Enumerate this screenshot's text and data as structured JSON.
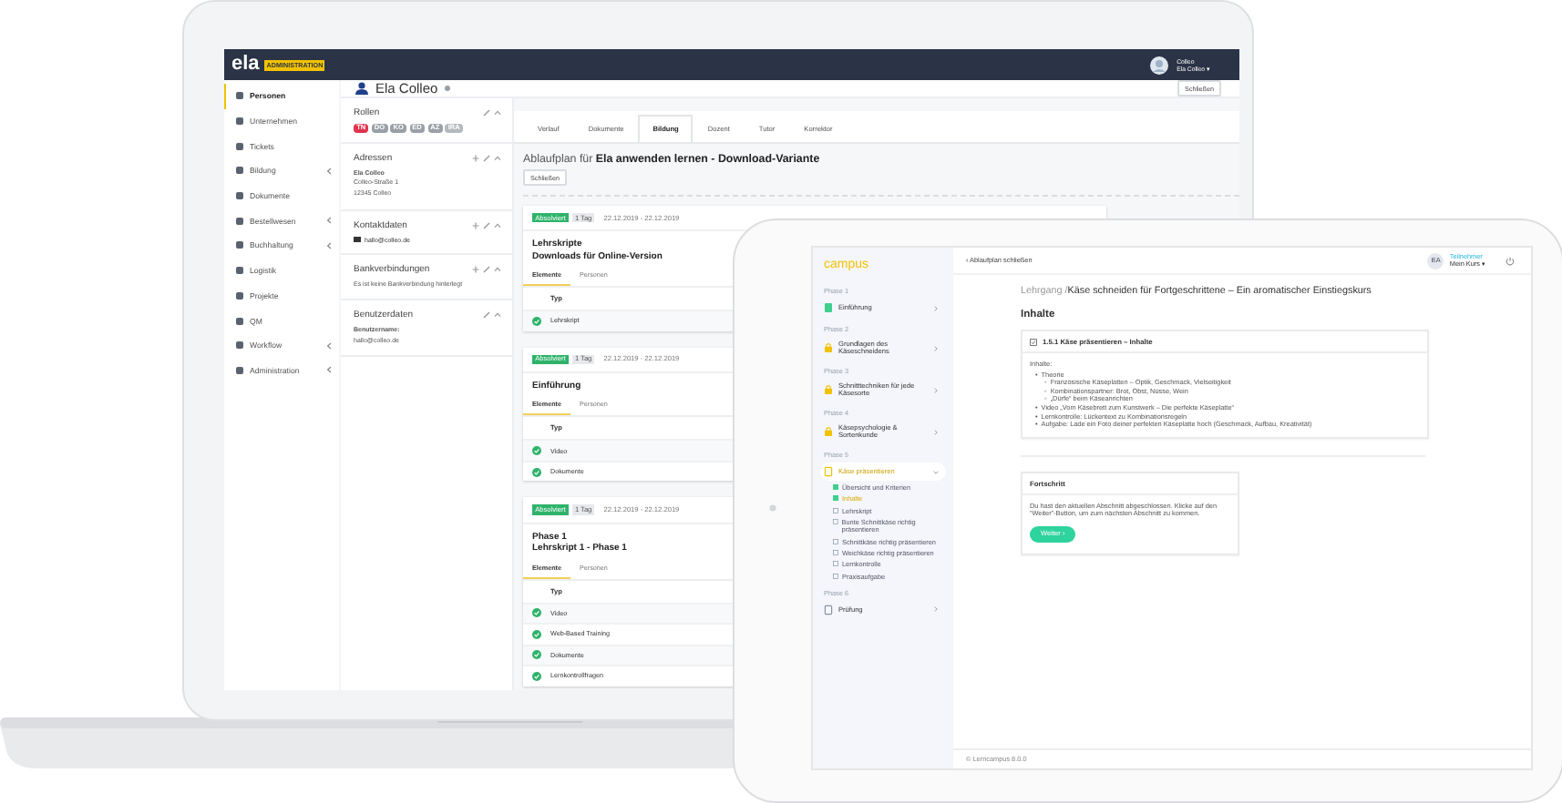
{
  "laptop": {
    "header": {
      "logo": "ela",
      "badge": "ADMINISTRATION",
      "user_line1": "Colleo",
      "user_line2": "Ela Colleo ▾"
    },
    "sidebar": [
      {
        "label": "Personen",
        "selected": true,
        "expandable": false
      },
      {
        "label": "Unternehmen",
        "selected": false,
        "expandable": false
      },
      {
        "label": "Tickets",
        "selected": false,
        "expandable": false
      },
      {
        "label": "Bildung",
        "selected": false,
        "expandable": true
      },
      {
        "label": "Dokumente",
        "selected": false,
        "expandable": false
      },
      {
        "label": "Bestellwesen",
        "selected": false,
        "expandable": true
      },
      {
        "label": "Buchhaltung",
        "selected": false,
        "expandable": true
      },
      {
        "label": "Logistik",
        "selected": false,
        "expandable": false
      },
      {
        "label": "Projekte",
        "selected": false,
        "expandable": false
      },
      {
        "label": "QM",
        "selected": false,
        "expandable": false
      },
      {
        "label": "Workflow",
        "selected": false,
        "expandable": true
      },
      {
        "label": "Administration",
        "selected": false,
        "expandable": true
      }
    ],
    "person": {
      "name": "Ela Colleo",
      "close": "Schließen"
    },
    "panels": [
      {
        "title": "Rollen",
        "addable": false,
        "roles": [
          {
            "label": "TN",
            "color": "#e0344c"
          },
          {
            "label": "DO",
            "color": "#9aa0a8"
          },
          {
            "label": "KO",
            "color": "#9aa0a8"
          },
          {
            "label": "ED",
            "color": "#9aa0a8"
          },
          {
            "label": "AZ",
            "color": "#9aa0a8"
          },
          {
            "label": "IRA",
            "color": "#b4b9bf"
          }
        ]
      },
      {
        "title": "Adressen",
        "addable": true,
        "lines": [
          "**Ela Colleo**",
          "Colleo-Straße 1",
          "12345 Colleo"
        ]
      },
      {
        "title": "Kontaktdaten",
        "addable": true,
        "email": "hallo@colleo.de"
      },
      {
        "title": "Bankverbindungen",
        "addable": true,
        "lines": [
          "Es ist keine Bankverbindung hinterlegt"
        ]
      },
      {
        "title": "Benutzerdaten",
        "addable": false,
        "lines": [
          "**Benutzername:**",
          "hallo@colleo.de"
        ]
      }
    ],
    "tabs": [
      {
        "label": "Verlauf",
        "selected": false
      },
      {
        "label": "Dokumente",
        "selected": false
      },
      {
        "label": "Bildung",
        "selected": true
      },
      {
        "label": "Dozent",
        "selected": false
      },
      {
        "label": "Tutor",
        "selected": false
      },
      {
        "label": "Korrektor",
        "selected": false
      }
    ],
    "plan_title": "Ablaufplan für **Ela anwenden lernen - Download-Variante**",
    "plan_close": "Schließen",
    "cards": [
      {
        "status": "Absolviert",
        "duration": "1 Tag",
        "dates": "22.12.2019 - 22.12.2019",
        "title_lines": [
          "Lehrskripte",
          "Downloads für Online-Version"
        ],
        "tabs": [
          {
            "label": "Elemente",
            "selected": true
          },
          {
            "label": "Personen",
            "selected": false
          }
        ],
        "column": "Typ",
        "rows": [
          "Lehrskript"
        ]
      },
      {
        "status": "Absolviert",
        "duration": "1 Tag",
        "dates": "22.12.2019 - 22.12.2019",
        "title_lines": [
          "Einführung"
        ],
        "tabs": [
          {
            "label": "Elemente",
            "selected": true
          },
          {
            "label": "Personen",
            "selected": false
          }
        ],
        "column": "Typ",
        "rows": [
          "Video",
          "Dokumente"
        ]
      },
      {
        "status": "Absolviert",
        "duration": "1 Tag",
        "dates": "22.12.2019 - 22.12.2019",
        "title_lines": [
          "Phase 1",
          "Lehrskript 1 - Phase 1"
        ],
        "tabs": [
          {
            "label": "Elemente",
            "selected": true
          },
          {
            "label": "Personen",
            "selected": false
          }
        ],
        "column": "Typ",
        "rows": [
          "Video",
          "Web-Based Training",
          "Dokumente",
          "Lernkontrollfragen"
        ]
      }
    ]
  },
  "tablet": {
    "logo": "campus",
    "phases": [
      {
        "phase": "Phase 1",
        "title": "Einführung",
        "kind": "done",
        "expanded": false
      },
      {
        "phase": "Phase 2",
        "title": "Grundlagen des Käseschneidens",
        "kind": "locked",
        "expanded": false
      },
      {
        "phase": "Phase 3",
        "title": "Schnitttechniken für jede Käsesorte",
        "kind": "locked",
        "expanded": false
      },
      {
        "phase": "Phase 4",
        "title": "Käsepsychologie & Sortenkunde",
        "kind": "locked",
        "expanded": false
      },
      {
        "phase": "Phase 5",
        "title": "Käse präsentieren",
        "kind": "current",
        "expanded": true,
        "children": [
          {
            "label": "Übersicht und Kriterien",
            "checked": true,
            "selected": false
          },
          {
            "label": "Inhalte",
            "checked": true,
            "selected": true
          },
          {
            "label": "Lehrskript",
            "checked": false,
            "selected": false
          },
          {
            "label": "Bunte Schnittkäse richtig präsentieren",
            "checked": false,
            "selected": false
          },
          {
            "label": "Schnittkäse richtig präsentieren",
            "checked": false,
            "selected": false
          },
          {
            "label": "Weichkäse richtig präsentieren",
            "checked": false,
            "selected": false
          },
          {
            "label": "Lernkontrolle",
            "checked": false,
            "selected": false
          },
          {
            "label": "Praxisaufgabe",
            "checked": false,
            "selected": false
          }
        ]
      },
      {
        "phase": "Phase 6",
        "title": "Prüfung",
        "kind": "open",
        "expanded": false
      }
    ],
    "back": "‹ Ablaufplan schließen",
    "avatar": "EA",
    "role": "Teilnehmer",
    "user": "Mein Kurs ▾",
    "breadcrumb_root": "Lehrgang /",
    "breadcrumb_title": "Käse schneiden für Fortgeschrittene – Ein aromatischer Einstiegskurs",
    "heading": "Inhalte",
    "content_card": {
      "title": "1.5.1 Käse präsentieren – Inhalte",
      "intro": "Inhalte:",
      "items": [
        {
          "marker": "•",
          "text": "Theorie",
          "children": [
            {
              "marker": "◦",
              "text": "Französische Käseplatten – Optik, Geschmack, Vielseitigkeit"
            },
            {
              "marker": "◦",
              "text": "Kombinationspartner: Brot, Obst, Nüsse, Wein"
            },
            {
              "marker": "◦",
              "text": "„Dürfe“ beim Käseanrichten"
            }
          ]
        },
        {
          "marker": "•",
          "text": "Video „Vom Käsebrett zum Kunstwerk – Die perfekte Käseplatte“"
        },
        {
          "marker": "•",
          "text": "Lernkontrolle: Lückentext zu Kombinationsregeln"
        },
        {
          "marker": "•",
          "text": "Aufgabe: Lade ein Foto deiner perfekten Käseplatte hoch (Geschmack, Aufbau, Kreativität)"
        }
      ]
    },
    "progress_card": {
      "title": "Fortschritt",
      "text": "Du hast den aktuellen Abschnitt abgeschlossen. Klicke auf den “Weiter”-Button, um zum nächsten Abschnitt zu kommen.",
      "button": "Weiter ›"
    },
    "footer": "© Lerncampus 8.0.0"
  }
}
